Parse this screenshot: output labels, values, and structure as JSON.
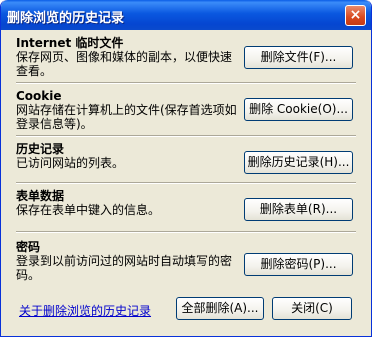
{
  "title": "删除浏览的历史记录",
  "close_glyph": "×",
  "sections": [
    {
      "title": "Internet 临时文件",
      "desc": "保存网页、图像和媒体的副本，以便快速查看。",
      "button": "删除文件(F)..."
    },
    {
      "title": "Cookie",
      "desc": "网站存储在计算机上的文件(保存首选项如登录信息等)。",
      "button": "删除 Cookie(O)..."
    },
    {
      "title": "历史记录",
      "desc": "已访问网站的列表。",
      "button": "删除历史记录(H)..."
    },
    {
      "title": "表单数据",
      "desc": "保存在表单中键入的信息。",
      "button": "删除表单(R)..."
    },
    {
      "title": "密码",
      "desc": "登录到以前访问过的网站时自动填写的密码。",
      "button": "删除密码(P)..."
    }
  ],
  "footer": {
    "link": "关于删除浏览的历史记录",
    "delete_all": "全部删除(A)...",
    "close": "关闭(C)"
  }
}
